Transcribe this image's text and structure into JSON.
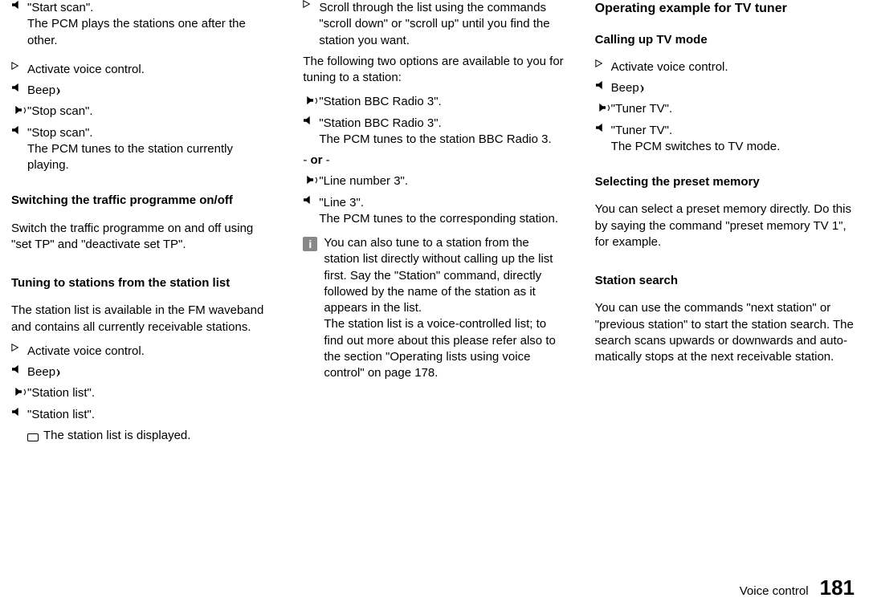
{
  "col1": {
    "i1_text": "\"Start scan\".",
    "i1_sub": "The PCM plays the stations one after the other.",
    "i2_text": "Activate voice control.",
    "i3_text": "Beep ",
    "i4_text": "\"Stop scan\".",
    "i5_text": "\"Stop scan\".",
    "i5_sub": "The PCM tunes to the station currently playing.",
    "h3a": "Switching the traffic programme on/off",
    "p1": "Switch the traffic programme on and off using \"set TP\" and \"deactivate set TP\".",
    "h3b": "Tuning to stations from the station list",
    "p2": "The station list is available in the FM waveband and contains all currently receivable stations.",
    "i6_text": "Activate voice control.",
    "i7_text": "Beep ",
    "i8_text": "\"Station list\".",
    "i9_text": "\"Station list\".",
    "i10_text": "The station list is displayed."
  },
  "col2": {
    "i1_text": "Scroll through the list using the commands \"scroll down\" or \"scroll up\" until you find the station you want.",
    "p1": "The following two options are available to you for tuning to a station:",
    "i2_text": "\"Station BBC Radio 3\".",
    "i3_text": "\"Station BBC Radio 3\".",
    "i3_sub": "The PCM tunes to the station BBC Radio 3.",
    "or_pre": "- ",
    "or_bold": "or",
    "or_post": " -",
    "i4_text": "\"Line number 3\".",
    "i5_text": "\"Line 3\".",
    "i5_sub": "The PCM tunes to the corresponding station.",
    "info_a": "You can also tune to a station from the station list directly without calling up the list first. Say the \"Station\" command, directly followed by the name of the station as it appears in the list.",
    "info_b": "The station list is a voice-controlled list; to find out more about this please refer also to the section \"Operating lists using voice control\" on page 178."
  },
  "col3": {
    "h2": "Operating example for TV tuner",
    "h3a": "Calling up TV mode",
    "i1_text": "Activate voice control.",
    "i2_text": "Beep ",
    "i3_text": "\"Tuner TV\".",
    "i4_text": "\"Tuner TV\".",
    "i4_sub": "The PCM switches to TV mode.",
    "h3b": "Selecting the preset memory",
    "p1": "You can select a preset memory directly. Do this by saying the command \"preset memory TV 1\", for example.",
    "h3c": "Station search",
    "p2": "You can use the commands \"next station\" or \"pre­vious station\" to start the station search. The search scans upwards or downwards and auto­matically stops at the next receivable station."
  },
  "footer": {
    "label": "Voice control",
    "page": "181"
  },
  "info_glyph": "i"
}
